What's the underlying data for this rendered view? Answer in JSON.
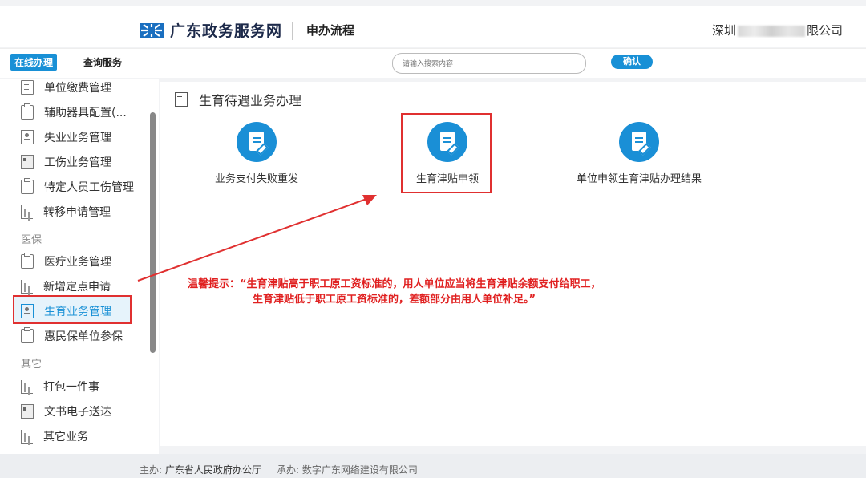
{
  "header": {
    "site_name": "广东政务服务网",
    "section": "申办流程",
    "company_prefix": "深圳",
    "company_suffix": "限公司"
  },
  "nav": {
    "active_tab": "在线办理",
    "tab2": "查询服务",
    "search_placeholder": "请输入搜索内容",
    "confirm_label": "确认"
  },
  "sidebar": {
    "items": [
      {
        "label": "单位缴费管理",
        "icon": "document-icon"
      },
      {
        "label": "辅助器具配置(...",
        "icon": "clipboard-icon"
      },
      {
        "label": "失业业务管理",
        "icon": "id-icon"
      },
      {
        "label": "工伤业务管理",
        "icon": "card-icon"
      },
      {
        "label": "特定人员工伤管理",
        "icon": "clipboard-icon"
      },
      {
        "label": "转移申请管理",
        "icon": "bar-icon"
      }
    ],
    "group_medical": "医保",
    "medical_items": [
      {
        "label": "医疗业务管理",
        "icon": "clipboard-icon"
      },
      {
        "label": "新增定点申请",
        "icon": "bar-icon"
      },
      {
        "label": "生育业务管理",
        "icon": "id-icon"
      },
      {
        "label": "惠民保单位参保",
        "icon": "clipboard-icon"
      }
    ],
    "group_other": "其它",
    "other_items": [
      {
        "label": "打包一件事",
        "icon": "bar-icon"
      },
      {
        "label": "文书电子送达",
        "icon": "card-icon"
      },
      {
        "label": "其它业务",
        "icon": "bar-icon"
      }
    ]
  },
  "main": {
    "title": "生育待遇业务办理",
    "services": [
      {
        "label": "业务支付失败重发"
      },
      {
        "label": "生育津贴申领"
      },
      {
        "label": "单位申领生育津贴办理结果"
      }
    ],
    "tip_line1": "温馨提示：“生育津贴高于职工原工资标准的，用人单位应当将生育津贴余额支付给职工，",
    "tip_line2": "生育津贴低于职工原工资标准的，差额部分由用人单位补足。”"
  },
  "footer": {
    "host_label": "主办:",
    "host": "广东省人民政府办公厅",
    "undertake_label": "承办:",
    "undertake": "数字广东网络建设有限公司"
  },
  "colors": {
    "accent": "#1890d6",
    "highlight": "#e03030"
  }
}
